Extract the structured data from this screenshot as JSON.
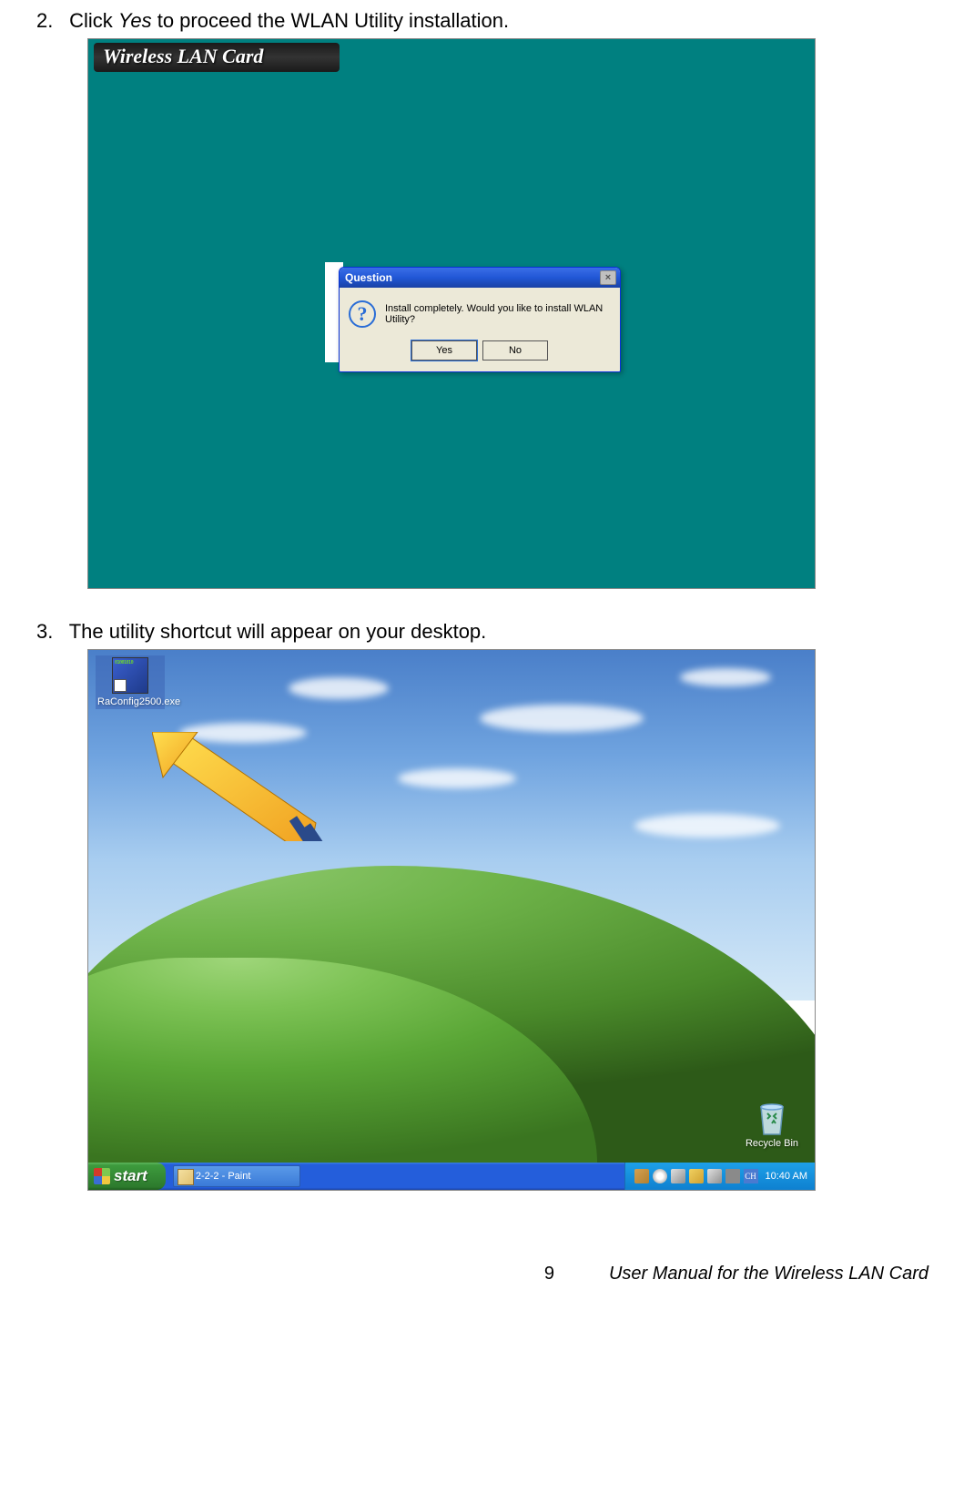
{
  "step2": {
    "number": "2.",
    "prefix": "Click ",
    "click_word": "Yes",
    "suffix": " to proceed the WLAN Utility installation."
  },
  "screenshot1": {
    "banner": "Wireless LAN Card",
    "dialog_title": "Question",
    "dialog_message": "Install completely. Would you like to install WLAN Utility?",
    "button_yes": "Yes",
    "button_no": "No"
  },
  "step3": {
    "number": "3.",
    "text": "The utility shortcut will appear on your desktop."
  },
  "screenshot2": {
    "shortcut_label": "RaConfig2500.exe",
    "recycle_label": "Recycle Bin",
    "start_label": "start",
    "task_item": "2-2-2 - Paint",
    "lang_icon": "CH",
    "clock": "10:40 AM"
  },
  "footer": {
    "page": "9",
    "title": "User Manual for the Wireless LAN Card"
  }
}
